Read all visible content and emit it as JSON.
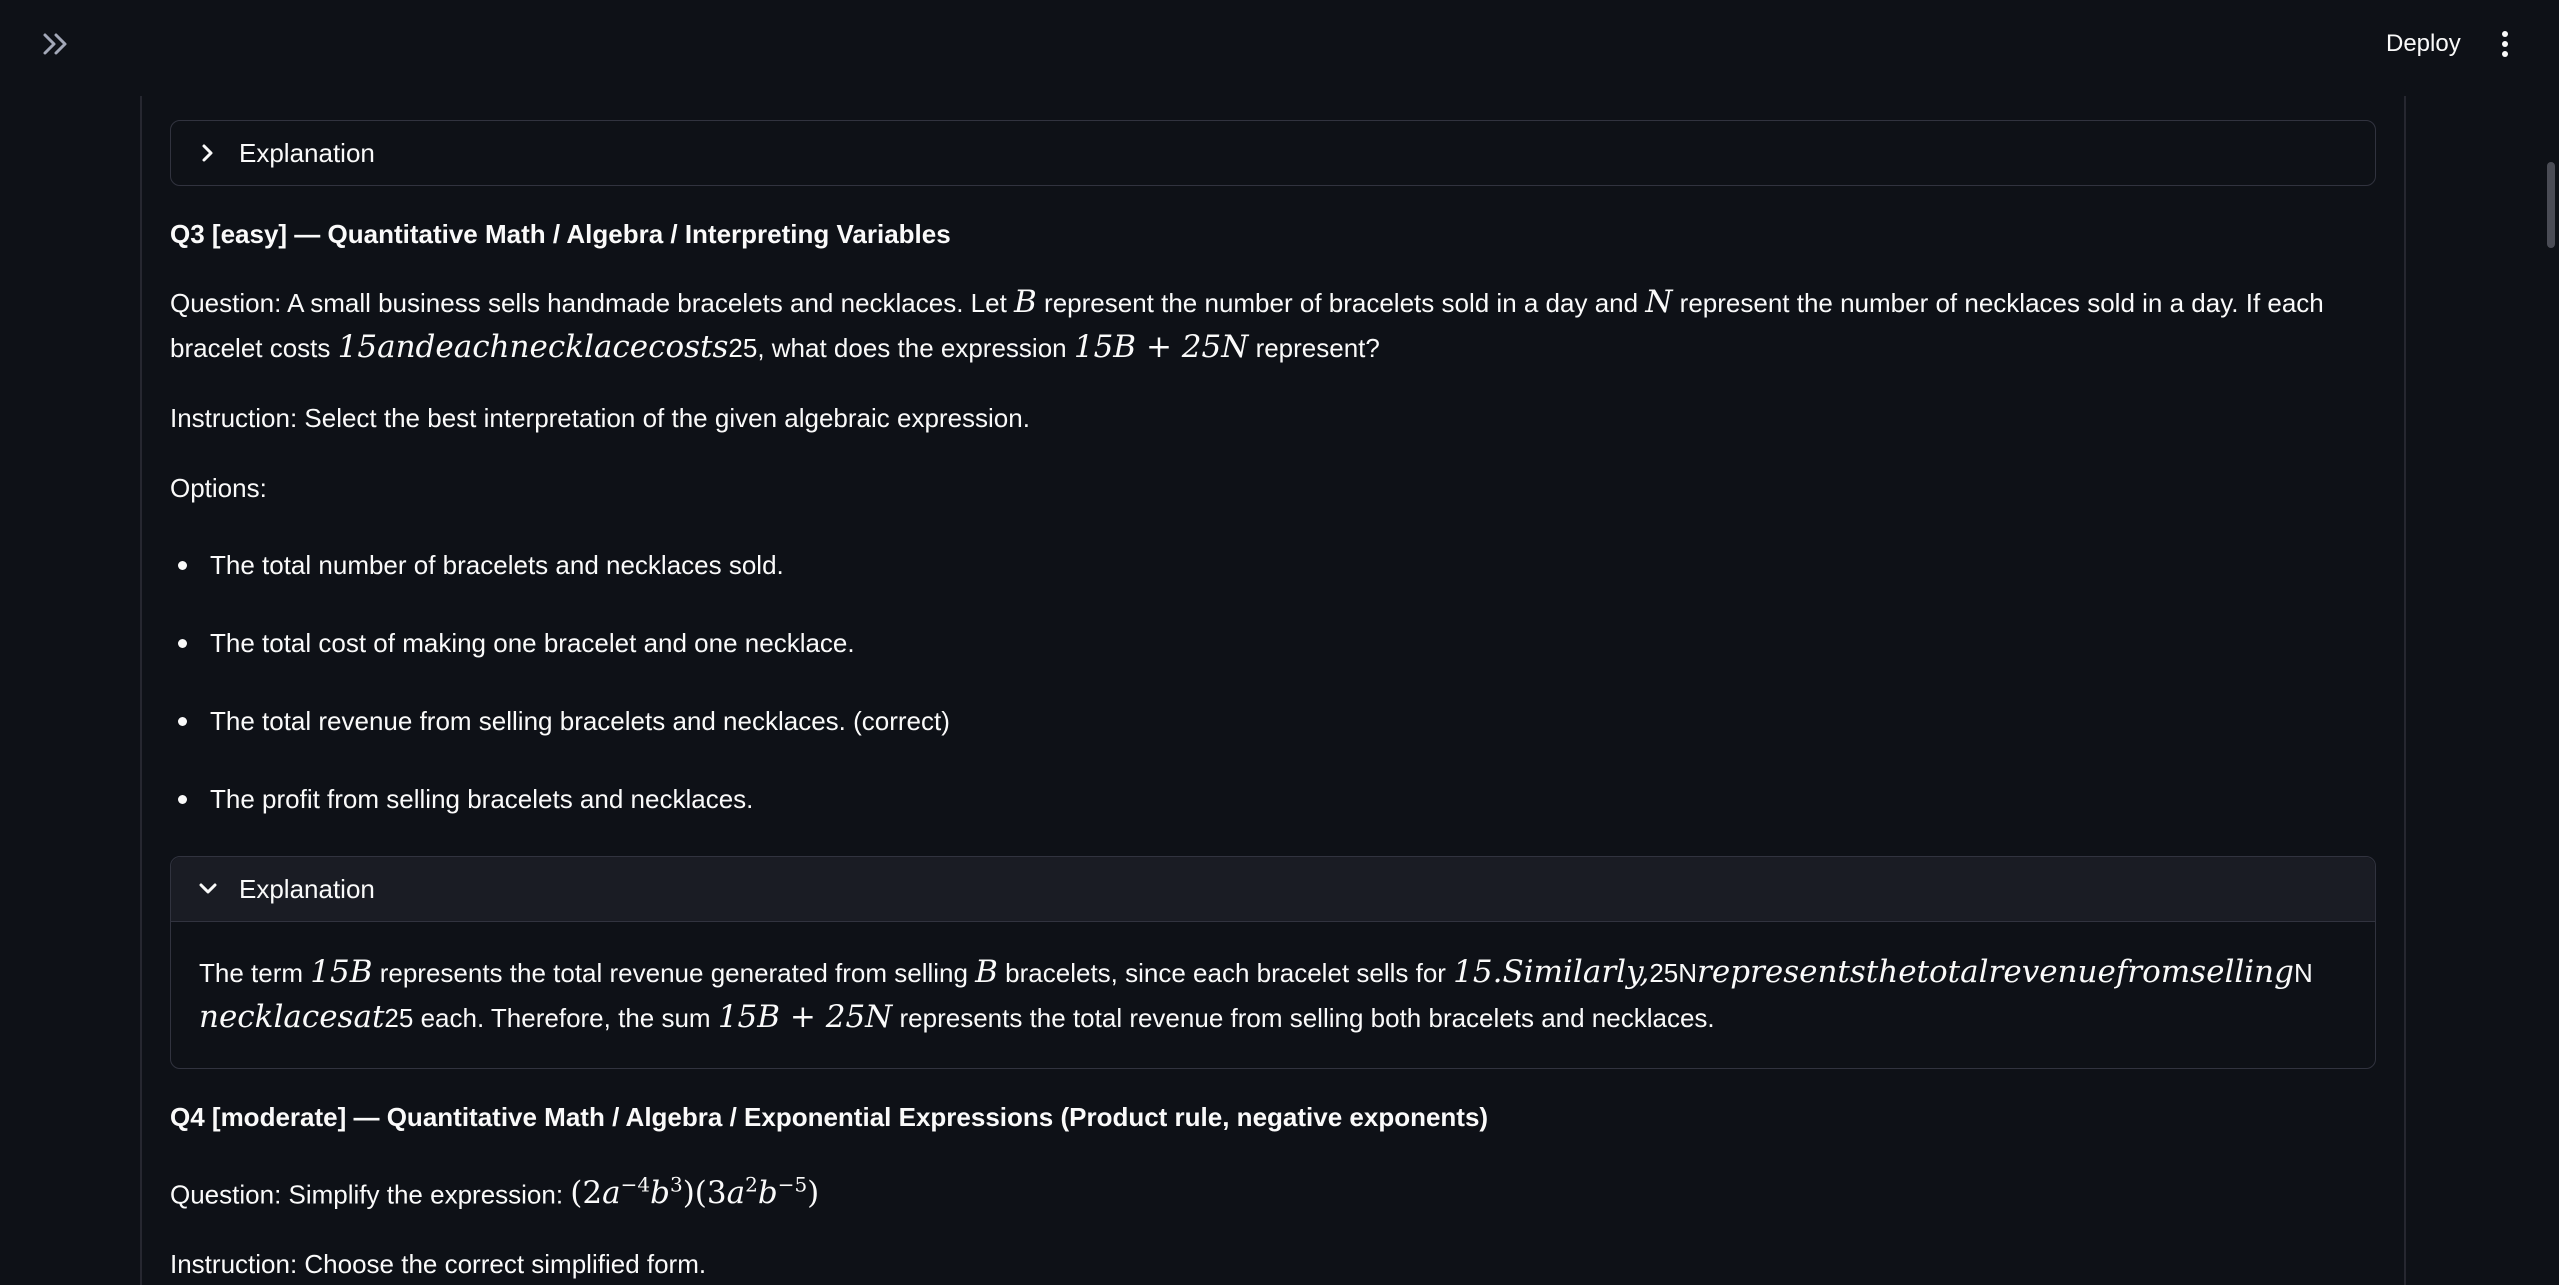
{
  "header": {
    "deploy_label": "Deploy"
  },
  "icons": {
    "sidebar_toggle": "double-chevron-right-icon",
    "menu": "vertical-ellipsis-icon"
  },
  "expander_top": {
    "label": "Explanation"
  },
  "q3": {
    "heading": "Q3 [easy] — Quantitative Math / Algebra / Interpreting Variables",
    "question_p1": "Question: A small business sells handmade bracelets and necklaces. Let ",
    "var_b": "B",
    "question_p2": " represent the number of bracelets sold in a day and ",
    "var_n": "N",
    "question_p3": " represent the number of necklaces sold in a day. If each bracelet costs ",
    "garbled_math": "15andeachnecklacecosts",
    "question_p4": "25, what does the expression ",
    "expr": "15B + 25N",
    "question_p5": " represent?",
    "instruction": "Instruction: Select the best interpretation of the given algebraic expression.",
    "options_label": "Options:",
    "options": [
      "The total number of bracelets and necklaces sold.",
      "The total cost of making one bracelet and one necklace.",
      "The total revenue from selling bracelets and necklaces. (correct)",
      "The profit from selling bracelets and necklaces."
    ],
    "explanation": {
      "label": "Explanation",
      "t1": "The term ",
      "m1": "15B",
      "t2": " represents the total revenue generated from selling ",
      "m2": "B",
      "t3": " bracelets, since each bracelet sells for ",
      "m3": "15.Similarly,",
      "t4": "25N",
      "m4": "representsthetotalrevenuefromselling",
      "t5": "N",
      "m5": "necklacesat",
      "t6": "25 each. Therefore, the sum ",
      "m6": "15B + 25N",
      "t7": " represents the total revenue from selling both bracelets and necklaces."
    }
  },
  "q4": {
    "heading": "Q4 [moderate] — Quantitative Math / Algebra / Exponential Expressions (Product rule, negative exponents)",
    "question_prefix": "Question: Simplify the expression: ",
    "instruction": "Instruction: Choose the correct simplified form."
  }
}
